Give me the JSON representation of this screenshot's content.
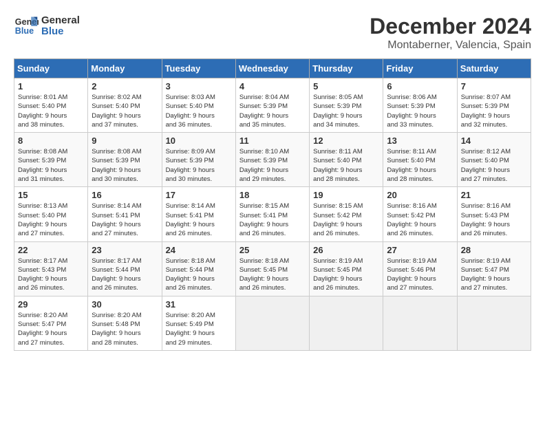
{
  "logo": {
    "line1": "General",
    "line2": "Blue"
  },
  "title": "December 2024",
  "subtitle": "Montaberner, Valencia, Spain",
  "days_of_week": [
    "Sunday",
    "Monday",
    "Tuesday",
    "Wednesday",
    "Thursday",
    "Friday",
    "Saturday"
  ],
  "weeks": [
    [
      {
        "day": 1,
        "info": "Sunrise: 8:01 AM\nSunset: 5:40 PM\nDaylight: 9 hours\nand 38 minutes."
      },
      {
        "day": 2,
        "info": "Sunrise: 8:02 AM\nSunset: 5:40 PM\nDaylight: 9 hours\nand 37 minutes."
      },
      {
        "day": 3,
        "info": "Sunrise: 8:03 AM\nSunset: 5:40 PM\nDaylight: 9 hours\nand 36 minutes."
      },
      {
        "day": 4,
        "info": "Sunrise: 8:04 AM\nSunset: 5:39 PM\nDaylight: 9 hours\nand 35 minutes."
      },
      {
        "day": 5,
        "info": "Sunrise: 8:05 AM\nSunset: 5:39 PM\nDaylight: 9 hours\nand 34 minutes."
      },
      {
        "day": 6,
        "info": "Sunrise: 8:06 AM\nSunset: 5:39 PM\nDaylight: 9 hours\nand 33 minutes."
      },
      {
        "day": 7,
        "info": "Sunrise: 8:07 AM\nSunset: 5:39 PM\nDaylight: 9 hours\nand 32 minutes."
      }
    ],
    [
      {
        "day": 8,
        "info": "Sunrise: 8:08 AM\nSunset: 5:39 PM\nDaylight: 9 hours\nand 31 minutes."
      },
      {
        "day": 9,
        "info": "Sunrise: 8:08 AM\nSunset: 5:39 PM\nDaylight: 9 hours\nand 30 minutes."
      },
      {
        "day": 10,
        "info": "Sunrise: 8:09 AM\nSunset: 5:39 PM\nDaylight: 9 hours\nand 30 minutes."
      },
      {
        "day": 11,
        "info": "Sunrise: 8:10 AM\nSunset: 5:39 PM\nDaylight: 9 hours\nand 29 minutes."
      },
      {
        "day": 12,
        "info": "Sunrise: 8:11 AM\nSunset: 5:40 PM\nDaylight: 9 hours\nand 28 minutes."
      },
      {
        "day": 13,
        "info": "Sunrise: 8:11 AM\nSunset: 5:40 PM\nDaylight: 9 hours\nand 28 minutes."
      },
      {
        "day": 14,
        "info": "Sunrise: 8:12 AM\nSunset: 5:40 PM\nDaylight: 9 hours\nand 27 minutes."
      }
    ],
    [
      {
        "day": 15,
        "info": "Sunrise: 8:13 AM\nSunset: 5:40 PM\nDaylight: 9 hours\nand 27 minutes."
      },
      {
        "day": 16,
        "info": "Sunrise: 8:14 AM\nSunset: 5:41 PM\nDaylight: 9 hours\nand 27 minutes."
      },
      {
        "day": 17,
        "info": "Sunrise: 8:14 AM\nSunset: 5:41 PM\nDaylight: 9 hours\nand 26 minutes."
      },
      {
        "day": 18,
        "info": "Sunrise: 8:15 AM\nSunset: 5:41 PM\nDaylight: 9 hours\nand 26 minutes."
      },
      {
        "day": 19,
        "info": "Sunrise: 8:15 AM\nSunset: 5:42 PM\nDaylight: 9 hours\nand 26 minutes."
      },
      {
        "day": 20,
        "info": "Sunrise: 8:16 AM\nSunset: 5:42 PM\nDaylight: 9 hours\nand 26 minutes."
      },
      {
        "day": 21,
        "info": "Sunrise: 8:16 AM\nSunset: 5:43 PM\nDaylight: 9 hours\nand 26 minutes."
      }
    ],
    [
      {
        "day": 22,
        "info": "Sunrise: 8:17 AM\nSunset: 5:43 PM\nDaylight: 9 hours\nand 26 minutes."
      },
      {
        "day": 23,
        "info": "Sunrise: 8:17 AM\nSunset: 5:44 PM\nDaylight: 9 hours\nand 26 minutes."
      },
      {
        "day": 24,
        "info": "Sunrise: 8:18 AM\nSunset: 5:44 PM\nDaylight: 9 hours\nand 26 minutes."
      },
      {
        "day": 25,
        "info": "Sunrise: 8:18 AM\nSunset: 5:45 PM\nDaylight: 9 hours\nand 26 minutes."
      },
      {
        "day": 26,
        "info": "Sunrise: 8:19 AM\nSunset: 5:45 PM\nDaylight: 9 hours\nand 26 minutes."
      },
      {
        "day": 27,
        "info": "Sunrise: 8:19 AM\nSunset: 5:46 PM\nDaylight: 9 hours\nand 27 minutes."
      },
      {
        "day": 28,
        "info": "Sunrise: 8:19 AM\nSunset: 5:47 PM\nDaylight: 9 hours\nand 27 minutes."
      }
    ],
    [
      {
        "day": 29,
        "info": "Sunrise: 8:20 AM\nSunset: 5:47 PM\nDaylight: 9 hours\nand 27 minutes."
      },
      {
        "day": 30,
        "info": "Sunrise: 8:20 AM\nSunset: 5:48 PM\nDaylight: 9 hours\nand 28 minutes."
      },
      {
        "day": 31,
        "info": "Sunrise: 8:20 AM\nSunset: 5:49 PM\nDaylight: 9 hours\nand 29 minutes."
      },
      null,
      null,
      null,
      null
    ]
  ]
}
